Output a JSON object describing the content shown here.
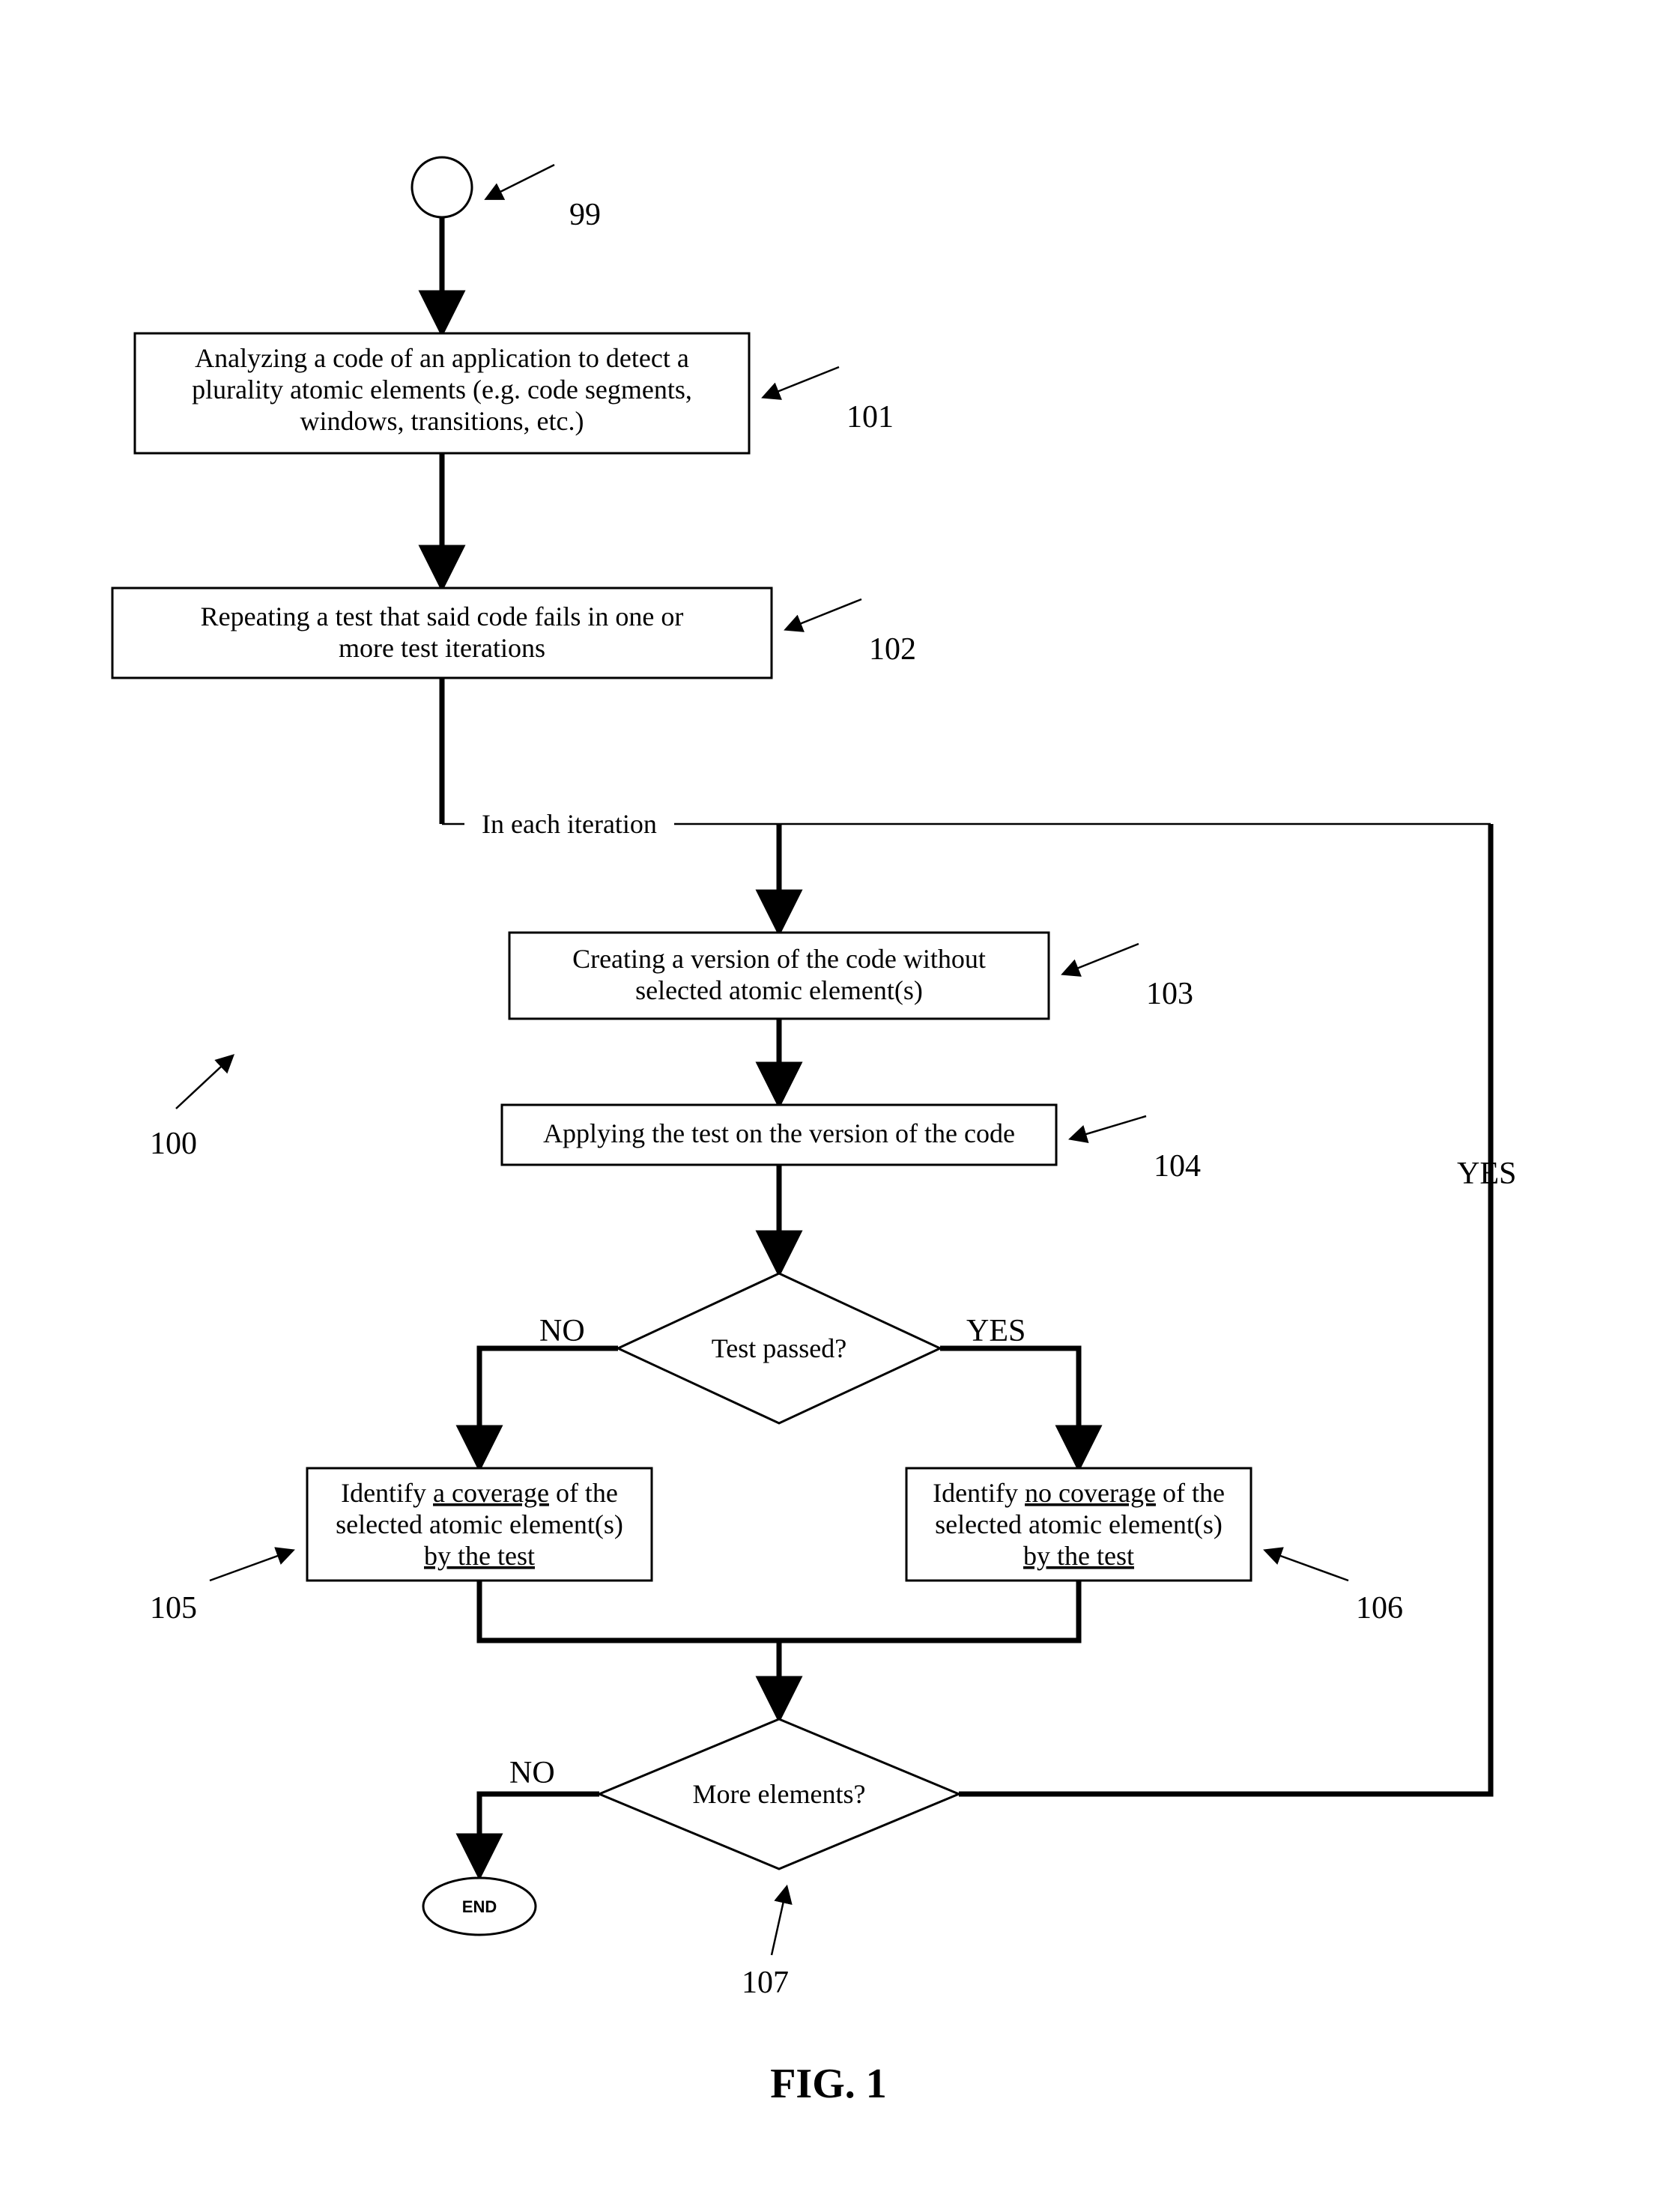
{
  "figure_label": "FIG. 1",
  "refs": {
    "start": "99",
    "analyze": "101",
    "repeat": "102",
    "create_version": "103",
    "apply_test": "104",
    "coverage": "105",
    "no_coverage": "106",
    "more_elements": "107",
    "method": "100"
  },
  "nodes": {
    "analyze_l1": "Analyzing a code of an application to detect a",
    "analyze_l2": "plurality atomic elements (e.g. code segments,",
    "analyze_l3": "windows, transitions, etc.)",
    "repeat_l1": "Repeating a test that said code fails in one or",
    "repeat_l2": "more test iterations",
    "iteration_label": "In each iteration",
    "create_l1": "Creating a version of the code without",
    "create_l2": "selected atomic element(s)",
    "apply_l1": "Applying the test on the version of the code",
    "decision1": "Test passed?",
    "decision2": "More elements?",
    "cov_l1a": "Identify ",
    "cov_l1b": "a coverage",
    "cov_l1c": " of the",
    "cov_l2": "selected atomic element(s)",
    "cov_l3": "by the test",
    "nocov_l1a": "Identify ",
    "nocov_l1b": "no coverage",
    "nocov_l1c": " of the",
    "nocov_l2": "selected atomic element(s)",
    "nocov_l3": "by the test",
    "end": "END"
  },
  "edges": {
    "no": "NO",
    "yes": "YES"
  }
}
